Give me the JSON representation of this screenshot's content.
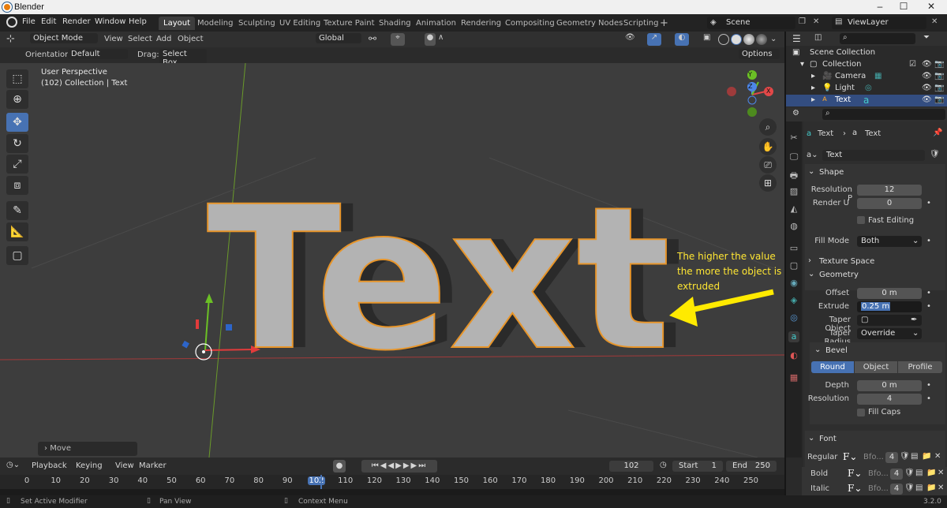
{
  "window": {
    "title": "Blender",
    "minimize": "–",
    "maximize": "☐",
    "close": "✕"
  },
  "menubar": {
    "menus": [
      "File",
      "Edit",
      "Render",
      "Window",
      "Help"
    ],
    "workspaces": [
      "Layout",
      "Modeling",
      "Sculpting",
      "UV Editing",
      "Texture Paint",
      "Shading",
      "Animation",
      "Rendering",
      "Compositing",
      "Geometry Nodes",
      "Scripting"
    ],
    "active_workspace": "Layout",
    "add_tab": "+",
    "scene": "Scene",
    "view_layer": "ViewLayer"
  },
  "header3d": {
    "mode": "Object Mode",
    "menus": [
      "View",
      "Select",
      "Add",
      "Object"
    ],
    "transform_orientation": "Global",
    "orientation_label": "Orientation:",
    "orientation_value": "Default",
    "drag_label": "Drag:",
    "drag_value": "Select Box",
    "options": "Options"
  },
  "viewport": {
    "view_name": "User Perspective",
    "collection_info": "(102) Collection | Text",
    "text_object": "Text",
    "last_op": "Move",
    "annotation": "The higher the value the more the object is extruded",
    "gizmo_x": "X",
    "gizmo_y": "Y",
    "gizmo_z": "Z"
  },
  "outliner": {
    "root": "Scene Collection",
    "collection": "Collection",
    "items": [
      {
        "name": "Camera",
        "selected": false
      },
      {
        "name": "Light",
        "selected": false
      },
      {
        "name": "Text",
        "selected": true
      }
    ]
  },
  "properties": {
    "breadcrumb_object": "Text",
    "breadcrumb_data": "Text",
    "datablock": "Text",
    "shape": {
      "title": "Shape",
      "resolution_preview_label": "Resolution P",
      "resolution_preview": "12",
      "render_u_label": "Render U",
      "render_u": "0",
      "fast_editing": "Fast Editing",
      "fill_mode_label": "Fill Mode",
      "fill_mode": "Both"
    },
    "texture_space": "Texture Space",
    "geometry": {
      "title": "Geometry",
      "offset_label": "Offset",
      "offset": "0 m",
      "extrude_label": "Extrude",
      "extrude": "0.25 m",
      "taper_object_label": "Taper Object",
      "taper_radius_label": "Taper Radius",
      "taper_radius": "Override"
    },
    "bevel": {
      "title": "Bevel",
      "modes": [
        "Round",
        "Object",
        "Profile"
      ],
      "active_mode": "Round",
      "depth_label": "Depth",
      "depth": "0 m",
      "resolution_label": "Resolution",
      "resolution": "4",
      "fill_caps": "Fill Caps"
    },
    "font": {
      "title": "Font",
      "rows": [
        {
          "label": "Regular",
          "name": "Bfo...",
          "users": "4"
        },
        {
          "label": "Bold",
          "name": "Bfo...",
          "users": "4"
        },
        {
          "label": "Italic",
          "name": "Bfo...",
          "users": "4"
        }
      ]
    }
  },
  "timeline": {
    "menus": [
      "Playback",
      "Keying",
      "View",
      "Marker"
    ],
    "current_frame": "102",
    "start_label": "Start",
    "start": "1",
    "end_label": "End",
    "end": "250",
    "ticks": [
      "0",
      "10",
      "20",
      "30",
      "40",
      "50",
      "60",
      "70",
      "80",
      "90",
      "102",
      "110",
      "120",
      "130",
      "140",
      "150",
      "160",
      "170",
      "180",
      "190",
      "200",
      "210",
      "220",
      "230",
      "240",
      "250"
    ]
  },
  "statusbar": {
    "left": "Set Active Modifier",
    "middle": "Pan View",
    "right": "Context Menu",
    "version": "3.2.0"
  },
  "colors": {
    "accent": "#4772b3",
    "selection_outline": "#f0a030",
    "annotation": "#ffe633",
    "playhead": "#4772b3"
  }
}
